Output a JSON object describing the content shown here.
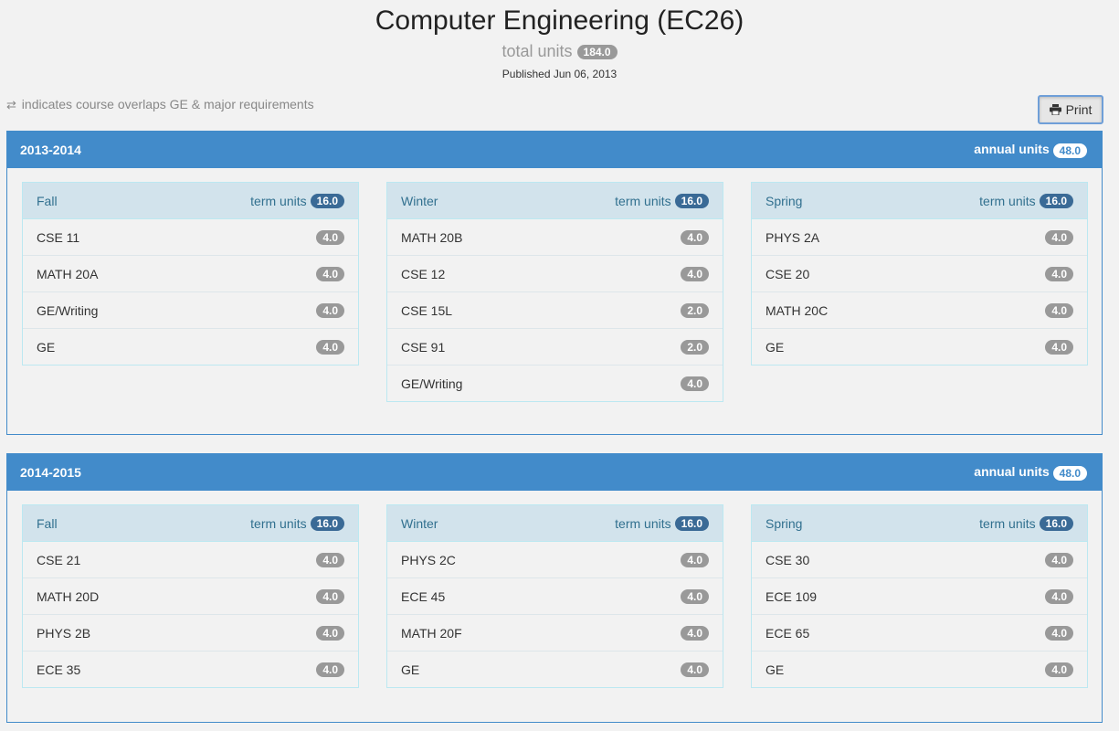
{
  "header": {
    "title": "Computer Engineering (EC26)",
    "total_units_label": "total units",
    "total_units": "184.0",
    "published": "Published Jun 06, 2013"
  },
  "legend": {
    "icon": "exchange-arrows-icon",
    "text": "indicates course overlaps GE & major requirements"
  },
  "print": {
    "label": "Print",
    "icon": "printer-icon"
  },
  "annual_units_label": "annual units",
  "term_units_label": "term units",
  "years": [
    {
      "label": "2013-2014",
      "annual_units": "48.0",
      "terms": [
        {
          "name": "Fall",
          "units": "16.0",
          "courses": [
            {
              "name": "CSE 11",
              "units": "4.0"
            },
            {
              "name": "MATH 20A",
              "units": "4.0"
            },
            {
              "name": "GE/Writing",
              "units": "4.0"
            },
            {
              "name": "GE",
              "units": "4.0"
            }
          ]
        },
        {
          "name": "Winter",
          "units": "16.0",
          "courses": [
            {
              "name": "MATH 20B",
              "units": "4.0"
            },
            {
              "name": "CSE 12",
              "units": "4.0"
            },
            {
              "name": "CSE 15L",
              "units": "2.0"
            },
            {
              "name": "CSE 91",
              "units": "2.0"
            },
            {
              "name": "GE/Writing",
              "units": "4.0"
            }
          ]
        },
        {
          "name": "Spring",
          "units": "16.0",
          "courses": [
            {
              "name": "PHYS 2A",
              "units": "4.0"
            },
            {
              "name": "CSE 20",
              "units": "4.0"
            },
            {
              "name": "MATH 20C",
              "units": "4.0"
            },
            {
              "name": "GE",
              "units": "4.0"
            }
          ]
        }
      ]
    },
    {
      "label": "2014-2015",
      "annual_units": "48.0",
      "terms": [
        {
          "name": "Fall",
          "units": "16.0",
          "courses": [
            {
              "name": "CSE 21",
              "units": "4.0"
            },
            {
              "name": "MATH 20D",
              "units": "4.0"
            },
            {
              "name": "PHYS 2B",
              "units": "4.0"
            },
            {
              "name": "ECE 35",
              "units": "4.0"
            }
          ]
        },
        {
          "name": "Winter",
          "units": "16.0",
          "courses": [
            {
              "name": "PHYS 2C",
              "units": "4.0"
            },
            {
              "name": "ECE 45",
              "units": "4.0"
            },
            {
              "name": "MATH 20F",
              "units": "4.0"
            },
            {
              "name": "GE",
              "units": "4.0"
            }
          ]
        },
        {
          "name": "Spring",
          "units": "16.0",
          "courses": [
            {
              "name": "CSE 30",
              "units": "4.0"
            },
            {
              "name": "ECE 109",
              "units": "4.0"
            },
            {
              "name": "ECE 65",
              "units": "4.0"
            },
            {
              "name": "GE",
              "units": "4.0"
            }
          ]
        }
      ]
    }
  ]
}
